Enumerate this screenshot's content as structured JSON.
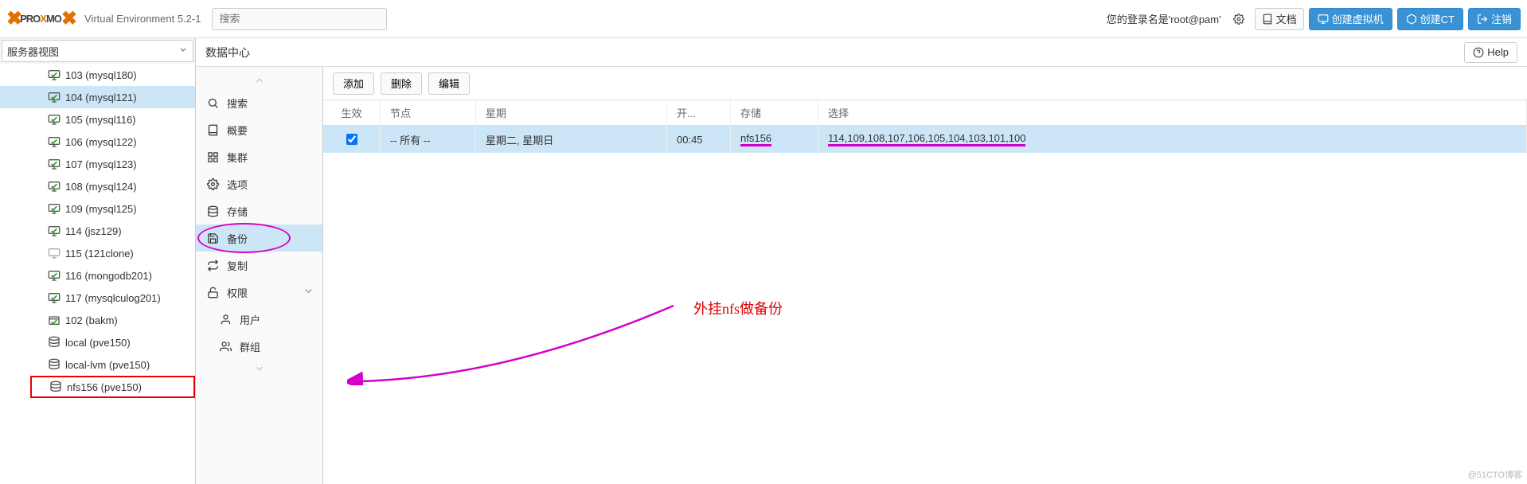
{
  "header": {
    "brand_prefix": "PRO",
    "brand_highlight": "X",
    "brand_suffix": "MO",
    "version": "Virtual Environment 5.2-1",
    "search_placeholder": "搜索",
    "login_text": "您的登录名是'root@pam'",
    "docs_label": "文档",
    "create_vm": "创建虚拟机",
    "create_ct": "创建CT",
    "logout": "注销"
  },
  "view_selector": "服务器视图",
  "tree": [
    {
      "id": "103",
      "label": "103 (mysql180)",
      "type": "vm",
      "selected": false
    },
    {
      "id": "104",
      "label": "104 (mysql121)",
      "type": "vm",
      "selected": true
    },
    {
      "id": "105",
      "label": "105 (mysql116)",
      "type": "vm",
      "selected": false
    },
    {
      "id": "106",
      "label": "106 (mysql122)",
      "type": "vm",
      "selected": false
    },
    {
      "id": "107",
      "label": "107 (mysql123)",
      "type": "vm",
      "selected": false
    },
    {
      "id": "108",
      "label": "108 (mysql124)",
      "type": "vm",
      "selected": false
    },
    {
      "id": "109",
      "label": "109 (mysql125)",
      "type": "vm",
      "selected": false
    },
    {
      "id": "114",
      "label": "114 (jsz129)",
      "type": "vm",
      "selected": false
    },
    {
      "id": "115",
      "label": "115 (121clone)",
      "type": "vm_off",
      "selected": false
    },
    {
      "id": "116",
      "label": "116 (mongodb201)",
      "type": "vm",
      "selected": false
    },
    {
      "id": "117",
      "label": "117 (mysqlculog201)",
      "type": "vm",
      "selected": false
    },
    {
      "id": "102",
      "label": "102 (bakm)",
      "type": "ct",
      "selected": false
    },
    {
      "id": "local",
      "label": "local (pve150)",
      "type": "storage",
      "selected": false
    },
    {
      "id": "local-lvm",
      "label": "local-lvm (pve150)",
      "type": "storage",
      "selected": false
    },
    {
      "id": "nfs156",
      "label": "nfs156 (pve150)",
      "type": "storage",
      "selected": false,
      "highlight": true
    }
  ],
  "breadcrumb": "数据中心",
  "help_label": "Help",
  "midmenu": [
    {
      "key": "search",
      "label": "搜索",
      "icon": "search"
    },
    {
      "key": "summary",
      "label": "概要",
      "icon": "book"
    },
    {
      "key": "cluster",
      "label": "集群",
      "icon": "cluster"
    },
    {
      "key": "options",
      "label": "选项",
      "icon": "gear"
    },
    {
      "key": "storage",
      "label": "存储",
      "icon": "db"
    },
    {
      "key": "backup",
      "label": "备份",
      "icon": "save",
      "selected": true,
      "circled": true
    },
    {
      "key": "replic",
      "label": "复制",
      "icon": "replic"
    },
    {
      "key": "perm",
      "label": "权限",
      "icon": "lock",
      "expandable": true
    },
    {
      "key": "users",
      "label": "用户",
      "icon": "user",
      "sub": true
    },
    {
      "key": "groups",
      "label": "群组",
      "icon": "users",
      "sub": true
    }
  ],
  "toolbar": {
    "add": "添加",
    "remove": "删除",
    "edit": "编辑"
  },
  "grid": {
    "headers": {
      "enable": "生效",
      "node": "节点",
      "dow": "星期",
      "start": "开...",
      "storage": "存储",
      "select": "选择"
    },
    "rows": [
      {
        "enabled": true,
        "node": "-- 所有 --",
        "dow": "星期二, 星期日",
        "start": "00:45",
        "storage": "nfs156",
        "select": "114,109,108,107,106,105,104,103,101,100"
      }
    ]
  },
  "annotation_text": "外挂nfs做备份",
  "watermark": "@51CTO博客"
}
